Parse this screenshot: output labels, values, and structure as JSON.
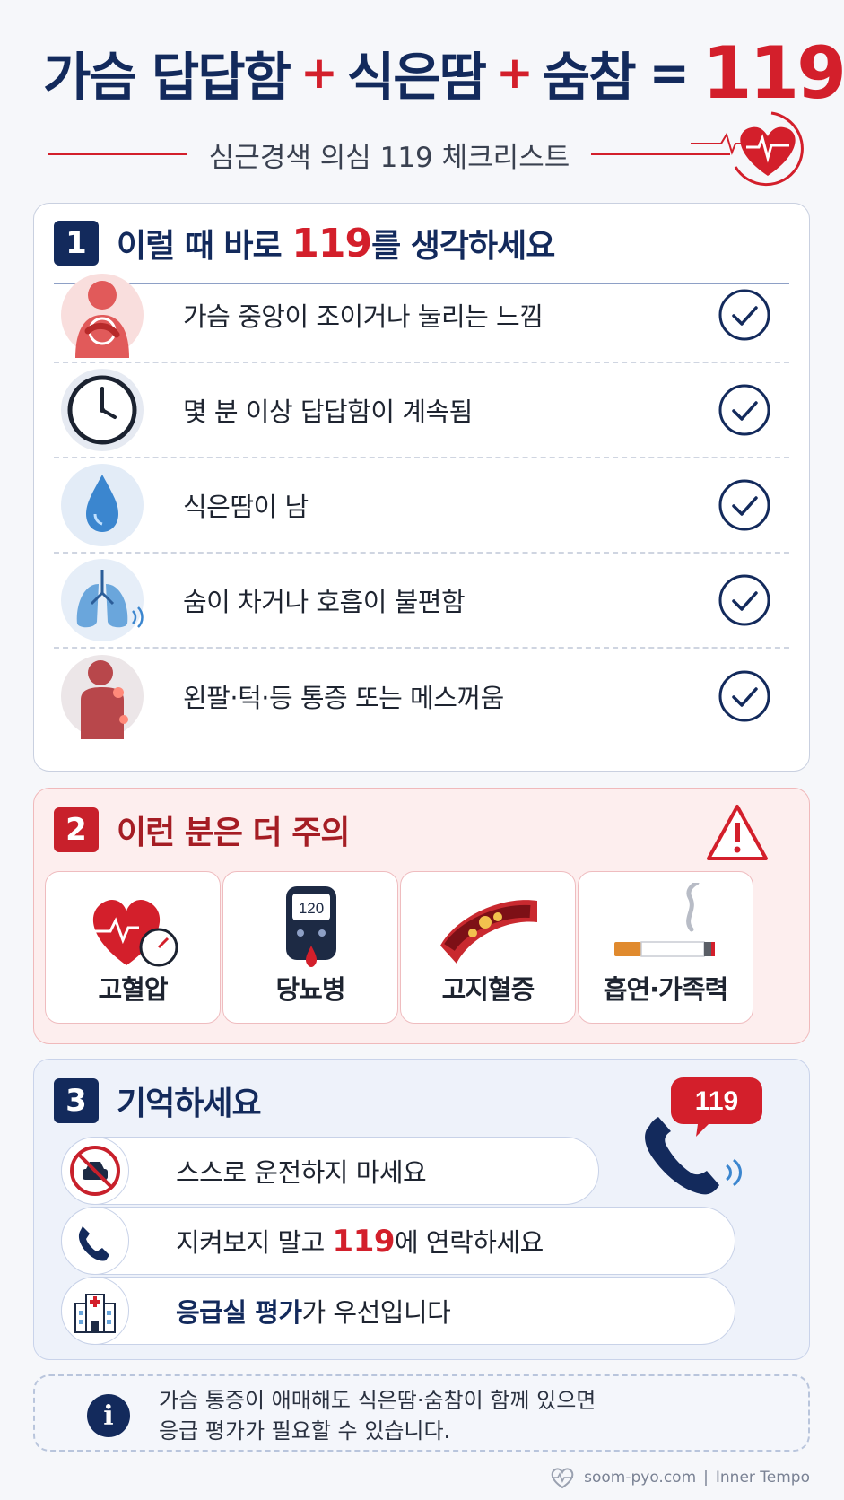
{
  "header": {
    "title_parts": [
      "가슴 답답함",
      "+",
      "식은땀",
      "+",
      "숨참",
      "=",
      "119"
    ],
    "subtitle": "심근경색 의심 119 체크리스트"
  },
  "section1": {
    "number": "1",
    "title_before": "이럴 때 바로",
    "title_highlight": "119",
    "title_after": "를 생각하세요",
    "items": [
      {
        "text": "가슴 중앙이 조이거나 눌리는 느낌",
        "icon": "chest-pain-icon",
        "checked": true
      },
      {
        "text": "몇 분 이상 답답함이 계속됨",
        "icon": "clock-icon",
        "checked": true
      },
      {
        "text": "식은땀이 남",
        "icon": "sweat-drop-icon",
        "checked": true
      },
      {
        "text": "숨이 차거나 호흡이 불편함",
        "icon": "lungs-icon",
        "checked": true
      },
      {
        "text": "왼팔·턱·등 통증 또는 메스꺼움",
        "icon": "arm-pain-icon",
        "checked": true
      }
    ]
  },
  "section2": {
    "number": "2",
    "title": "이런 분은 더 주의",
    "risks": [
      {
        "label": "고혈압",
        "icon": "heart-gauge-icon"
      },
      {
        "label": "당뇨병",
        "icon": "glucose-meter-icon",
        "meter_value": "120"
      },
      {
        "label": "고지혈증",
        "icon": "artery-plaque-icon"
      },
      {
        "label": "흡연·가족력",
        "icon": "cigarette-icon"
      }
    ]
  },
  "section3": {
    "number": "3",
    "title": "기억하세요",
    "phone_badge": "119",
    "items": [
      {
        "text": "스스로 운전하지 마세요",
        "icon": "no-driving-icon"
      },
      {
        "text_before": "지켜보지 말고 ",
        "text_highlight": "119",
        "text_after": "에 연락하세요",
        "icon": "phone-icon"
      },
      {
        "text_bold": "응급실 평가",
        "text_after": "가 우선입니다",
        "icon": "hospital-icon"
      }
    ]
  },
  "note": {
    "line1": "가슴 통증이 애매해도 식은땀·숨참이 함께 있으면",
    "line2": "응급 평가가 필요할 수 있습니다."
  },
  "footer": {
    "site": "soom-pyo.com",
    "separator": "|",
    "brand": "Inner Tempo"
  },
  "colors": {
    "navy": "#132a5c",
    "red": "#d31f2b",
    "pink_bg": "#fdeeee",
    "blue_bg": "#eef2fa"
  }
}
